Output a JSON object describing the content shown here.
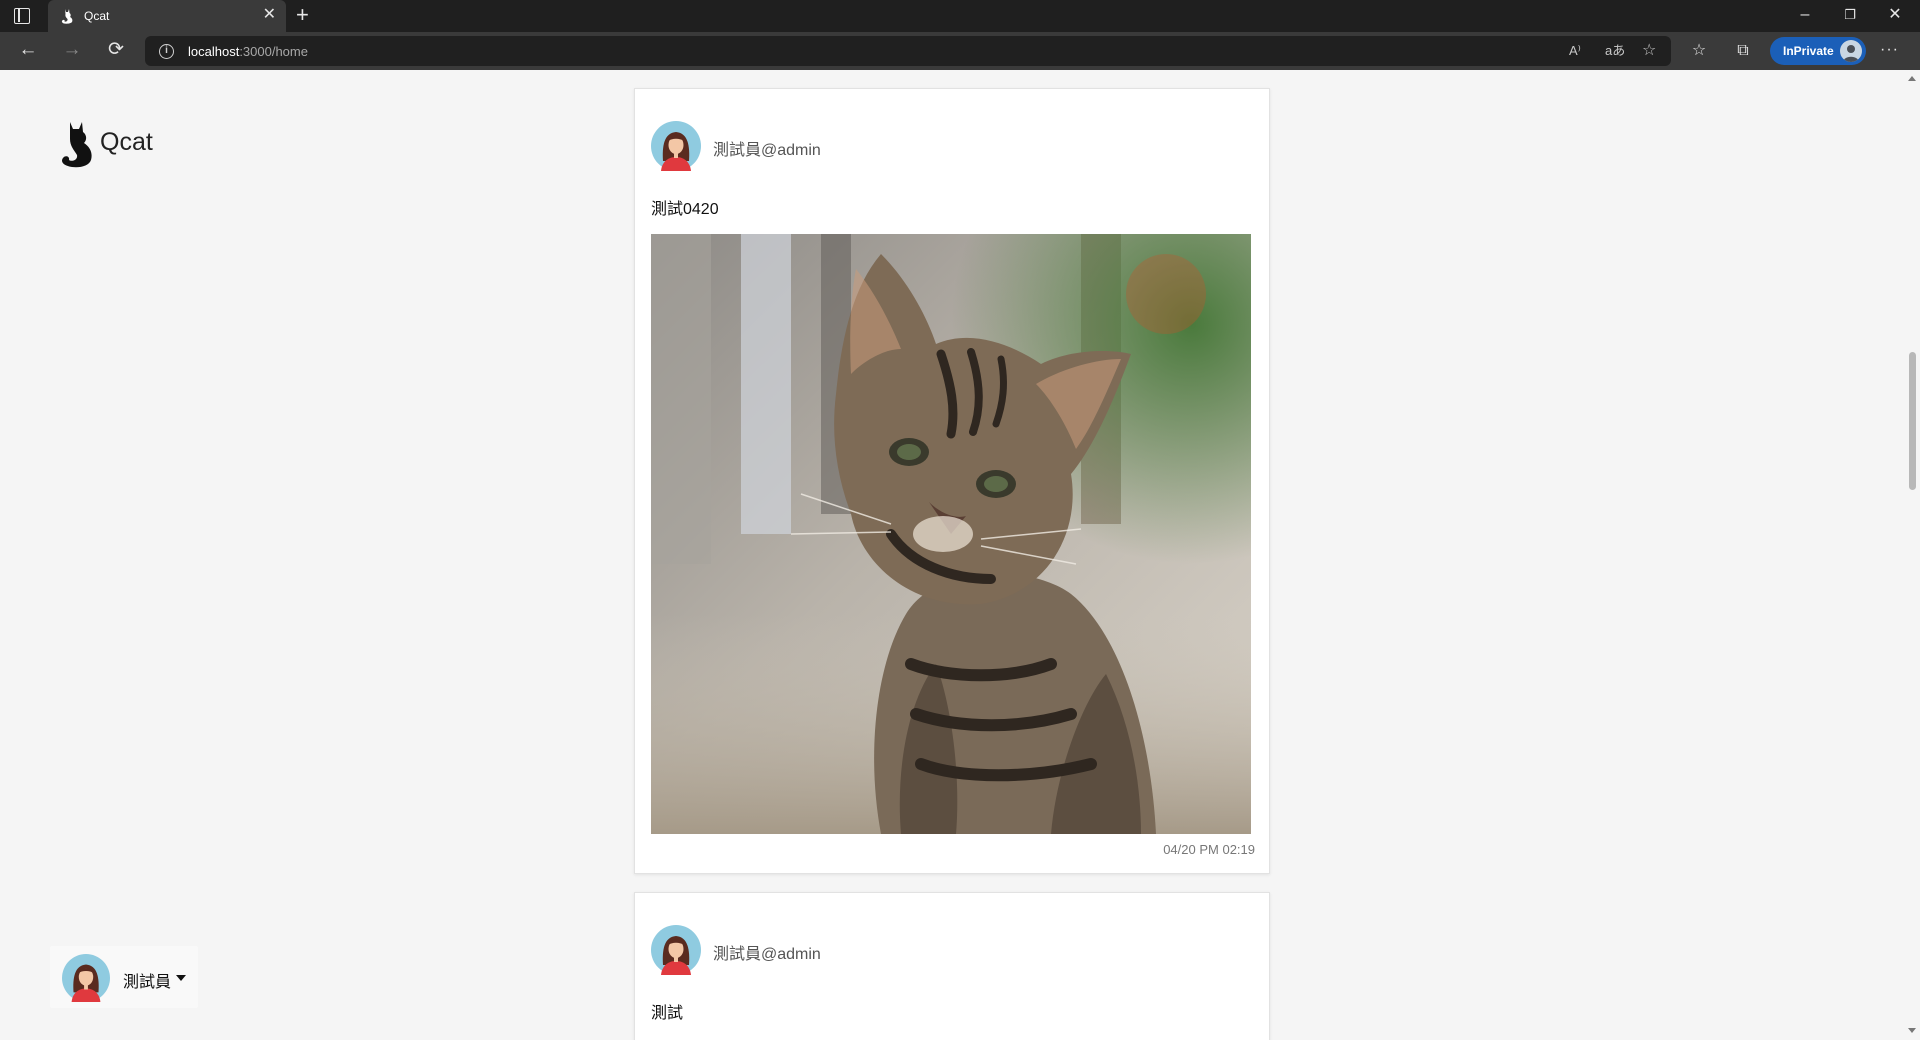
{
  "browser": {
    "tab_title": "Qcat",
    "url_host": "localhost",
    "url_rest": ":3000/home",
    "inprivate_label": "InPrivate",
    "icons": {
      "back": "←",
      "forward": "→",
      "refresh": "⟳",
      "info": "i",
      "read_aloud": "A⁾",
      "translate": "aあ",
      "favorite_add": "☆",
      "favorites": "☆",
      "collections": "⧉",
      "more": "···",
      "close_tab": "✕",
      "new_tab": "+",
      "minimize": "–",
      "restore": "❐",
      "close_window": "✕"
    }
  },
  "app": {
    "brand_name": "Qcat"
  },
  "current_user": {
    "name": "測試員"
  },
  "posts": [
    {
      "author": "測試員@admin",
      "text": "測試0420",
      "has_image": true,
      "time": "04/20 PM 02:19"
    },
    {
      "author": "測試員@admin",
      "text": "測試"
    }
  ],
  "colors": {
    "inprivate": "#1b5fb8",
    "avatar_bg": "#8fcbe0",
    "page_bg": "#f5f5f5"
  }
}
